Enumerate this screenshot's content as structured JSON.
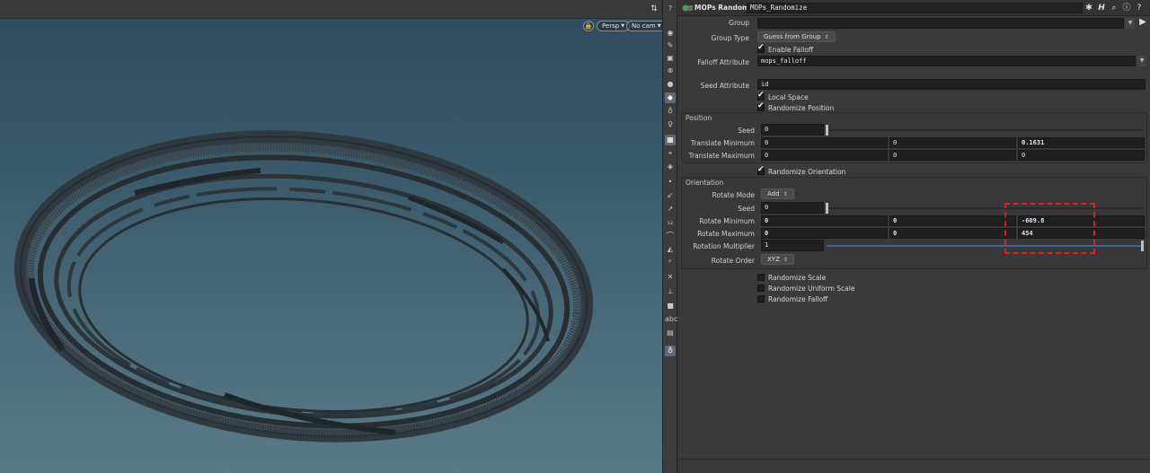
{
  "viewport": {
    "camera_mode": "Persp",
    "camera": "No cam"
  },
  "node": {
    "type_label": "MOPs Randomize",
    "name": "MOPs_Randomize"
  },
  "params": {
    "group": {
      "label": "Group",
      "value": ""
    },
    "group_type": {
      "label": "Group Type",
      "value": "Guess from Group"
    },
    "enable_falloff": {
      "label": "Enable Falloff",
      "checked": true
    },
    "falloff_attribute": {
      "label": "Falloff Attribute",
      "value": "mops_falloff"
    },
    "seed_attribute": {
      "label": "Seed Attribute",
      "value": "id"
    },
    "local_space": {
      "label": "Local Space",
      "checked": true
    },
    "randomize_position": {
      "label": "Randomize Position",
      "checked": true
    },
    "position": {
      "title": "Position",
      "seed": {
        "label": "Seed",
        "value": "0"
      },
      "translate_min": {
        "label": "Translate Minimum",
        "values": [
          "0",
          "0",
          "0.1631"
        ]
      },
      "translate_max": {
        "label": "Translate Maximum",
        "values": [
          "0",
          "0",
          "0"
        ]
      }
    },
    "randomize_orientation": {
      "label": "Randomize Orientation",
      "checked": true
    },
    "orientation": {
      "title": "Orientation",
      "rotate_mode": {
        "label": "Rotate Mode",
        "value": "Add"
      },
      "seed": {
        "label": "Seed",
        "value": "0"
      },
      "rotate_min": {
        "label": "Rotate Minimum",
        "values": [
          "0",
          "0",
          "-609.8"
        ]
      },
      "rotate_max": {
        "label": "Rotate Maximum",
        "values": [
          "0",
          "0",
          "454"
        ]
      },
      "rotation_multiplier": {
        "label": "Rotation Multiplier",
        "value": "1"
      },
      "rotate_order": {
        "label": "Rotate Order",
        "value": "XYZ"
      }
    },
    "randomize_scale": {
      "label": "Randomize Scale",
      "checked": false
    },
    "randomize_uniform_scale": {
      "label": "Randomize Uniform Scale",
      "checked": false
    },
    "randomize_falloff": {
      "label": "Randomize Falloff",
      "checked": false
    }
  },
  "colors": {
    "highlight": "#e02020",
    "ring": "#2b3236",
    "accent_blue": "#3f6590"
  }
}
